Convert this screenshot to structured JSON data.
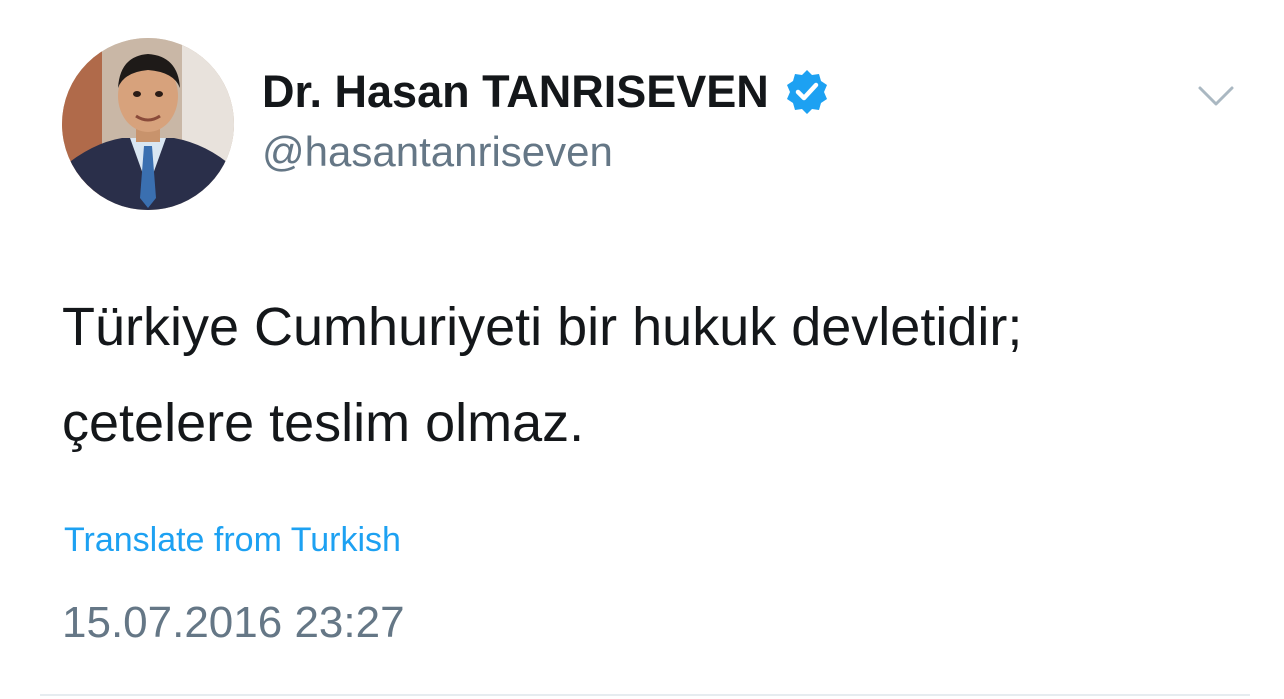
{
  "author": {
    "display_name": "Dr. Hasan TANRISEVEN",
    "handle": "@hasantanriseven",
    "verified": true
  },
  "tweet": {
    "line1": "Türkiye Cumhuriyeti bir hukuk devletidir;",
    "line2": "çetelere teslim olmaz.",
    "translate_label": "Translate from Turkish",
    "timestamp": "15.07.2016 23:27"
  },
  "icons": {
    "verified": "verified-badge-icon",
    "menu": "chevron-down-icon",
    "avatar": "avatar"
  },
  "colors": {
    "accent": "#1da1f2",
    "text": "#14171a",
    "secondary": "#657786",
    "divider": "#e6ecf0"
  }
}
